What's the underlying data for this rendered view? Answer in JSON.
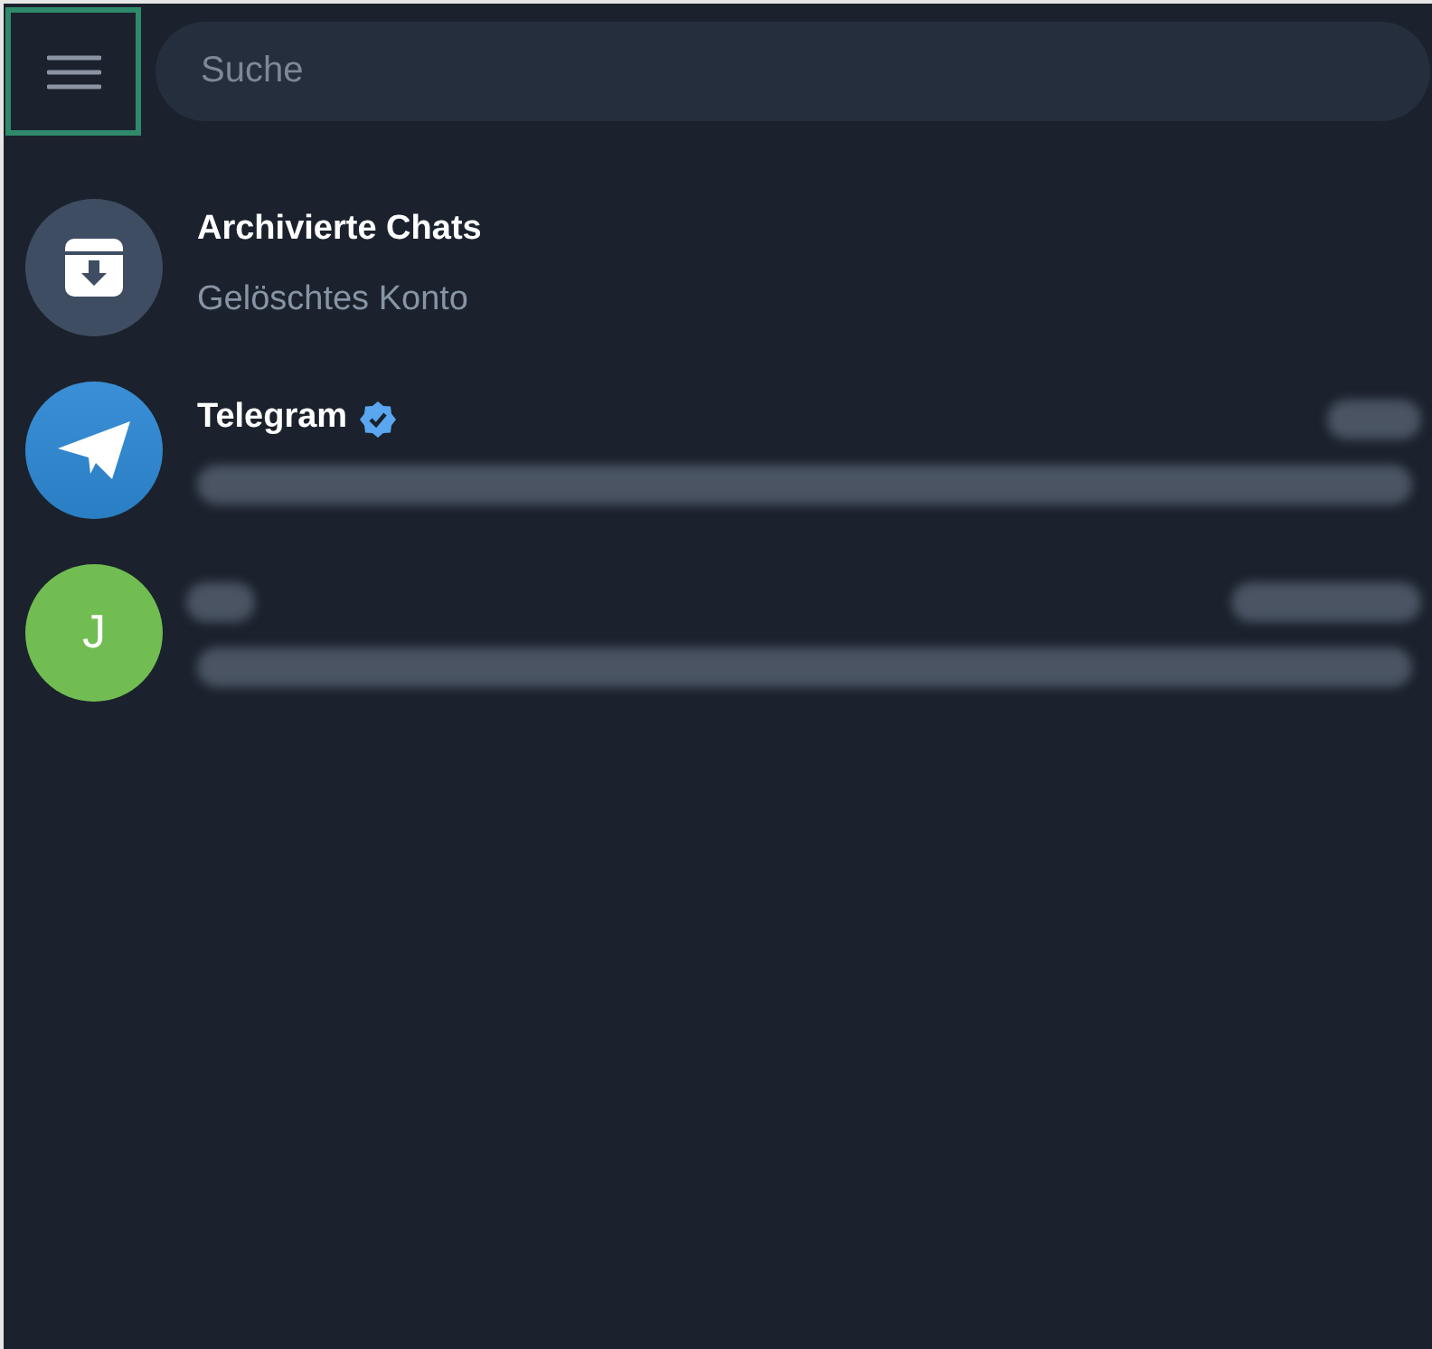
{
  "menu_button": {
    "focused": true
  },
  "search": {
    "placeholder": "Suche"
  },
  "chats": [
    {
      "kind": "archive",
      "color": "#3f4d63",
      "title": "Archivierte Chats",
      "subtitle": "Gelöschtes Konto"
    },
    {
      "kind": "telegram",
      "color": "#3b8fd6",
      "title": "Telegram",
      "verified": true
    },
    {
      "kind": "letter",
      "color": "#72bd52",
      "avatar_letter": "J"
    }
  ]
}
